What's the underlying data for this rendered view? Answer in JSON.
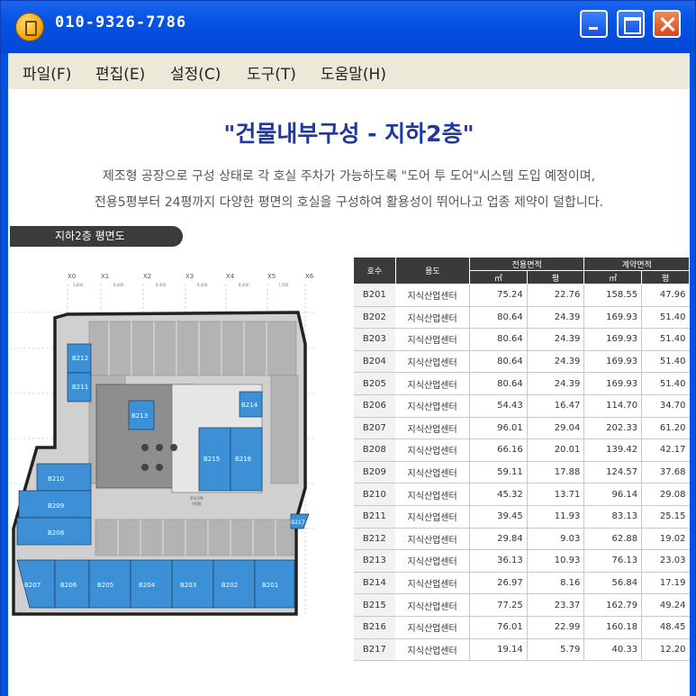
{
  "window": {
    "title": "010-9326-7786"
  },
  "menu": {
    "items": [
      "파일(F)",
      "편집(E)",
      "설정(C)",
      "도구(T)",
      "도움말(H)"
    ]
  },
  "page": {
    "heading": "\"건물내부구성 - 지하2층\"",
    "desc_line1": "제조형 공장으로 구성 상태로 각 호실 주차가 가능하도록 \"도어 투 도어\"시스템 도입 예정이며,",
    "desc_line2": "전용5평부터 24평까지 다양한 평면의 호실을 구성하여 활용성이 뛰어나고 업종 제약이 덜합니다.",
    "plan_tab": "지하2층 평면도"
  },
  "floorplan": {
    "grid_labels": [
      "X0",
      "X1",
      "X2",
      "X3",
      "X4",
      "X5",
      "X6"
    ],
    "dims": [
      "3,600",
      "8,400",
      "8,400",
      "8,400",
      "8,400",
      "7,500"
    ],
    "units_left": [
      "B212",
      "B211",
      "B210",
      "B209",
      "B208"
    ],
    "units_bottom": [
      "B207",
      "B206",
      "B205",
      "B204",
      "B203",
      "B202",
      "B201"
    ],
    "units_core": [
      "B213",
      "B214",
      "B215",
      "B216",
      "B217"
    ],
    "center_label_1": "주차구획",
    "center_label_2": "(차량)"
  },
  "table": {
    "headers": {
      "code": "호수",
      "use": "용도",
      "exclusive": "전용면적",
      "contract": "계약면적",
      "sqm": "㎡",
      "pyeong": "평"
    },
    "rows": [
      [
        "B201",
        "지식산업센터",
        "75.24",
        "22.76",
        "158.55",
        "47.96"
      ],
      [
        "B202",
        "지식산업센터",
        "80.64",
        "24.39",
        "169.93",
        "51.40"
      ],
      [
        "B203",
        "지식산업센터",
        "80.64",
        "24.39",
        "169.93",
        "51.40"
      ],
      [
        "B204",
        "지식산업센터",
        "80.64",
        "24.39",
        "169.93",
        "51.40"
      ],
      [
        "B205",
        "지식산업센터",
        "80.64",
        "24.39",
        "169.93",
        "51.40"
      ],
      [
        "B206",
        "지식산업센터",
        "54.43",
        "16.47",
        "114.70",
        "34.70"
      ],
      [
        "B207",
        "지식산업센터",
        "96.01",
        "29.04",
        "202.33",
        "61.20"
      ],
      [
        "B208",
        "지식산업센터",
        "66.16",
        "20.01",
        "139.42",
        "42.17"
      ],
      [
        "B209",
        "지식산업센터",
        "59.11",
        "17.88",
        "124.57",
        "37.68"
      ],
      [
        "B210",
        "지식산업센터",
        "45.32",
        "13.71",
        "96.14",
        "29.08"
      ],
      [
        "B211",
        "지식산업센터",
        "39.45",
        "11.93",
        "83.13",
        "25.15"
      ],
      [
        "B212",
        "지식산업센터",
        "29.84",
        "9.03",
        "62.88",
        "19.02"
      ],
      [
        "B213",
        "지식산업센터",
        "36.13",
        "10.93",
        "76.13",
        "23.03"
      ],
      [
        "B214",
        "지식산업센터",
        "26.97",
        "8.16",
        "56.84",
        "17.19"
      ],
      [
        "B215",
        "지식산업센터",
        "77.25",
        "23.37",
        "162.79",
        "49.24"
      ],
      [
        "B216",
        "지식산업센터",
        "76.01",
        "22.99",
        "160.18",
        "48.45"
      ],
      [
        "B217",
        "지식산업센터",
        "19.14",
        "5.79",
        "40.33",
        "12.20"
      ]
    ]
  },
  "colors": {
    "titlebar": "#0552e2",
    "unit_fill": "#3d8fd6",
    "heading": "#20399a",
    "table_header": "#3a3a3a"
  }
}
